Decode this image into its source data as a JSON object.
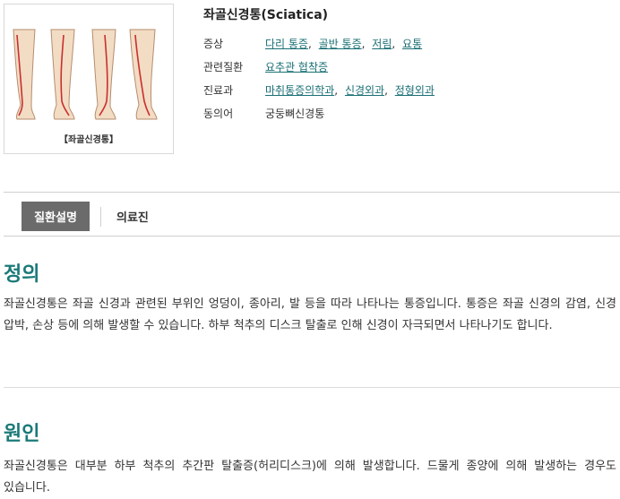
{
  "image": {
    "caption": "【좌골신경통】"
  },
  "disease": {
    "title": "좌골신경통(Sciatica)"
  },
  "info": {
    "symptom_label": "증상",
    "symptoms": [
      "다리 통증",
      "골반 통증",
      "저림",
      "요통"
    ],
    "related_label": "관련질환",
    "related": [
      "요추관 협착증"
    ],
    "dept_label": "진료과",
    "departments": [
      "마취통증의학과",
      "신경외과",
      "정형외과"
    ],
    "synonym_label": "동의어",
    "synonym": "궁둥뼈신경통"
  },
  "tabs": {
    "active": "질환설명",
    "other": "의료진"
  },
  "sections": {
    "definition": {
      "heading": "정의",
      "body": "좌골신경통은 좌골 신경과 관련된 부위인 엉덩이, 종아리, 발 등을 따라 나타나는 통증입니다. 통증은 좌골 신경의 감염, 신경 압박, 손상 등에 의해 발생할 수 있습니다. 하부 척추의 디스크 탈출로 인해 신경이 자극되면서 나타나기도 합니다."
    },
    "cause": {
      "heading": "원인",
      "body": "좌골신경통은 대부분 하부 척추의 추간판 탈출증(허리디스크)에 의해 발생합니다. 드물게 종양에 의해 발생하는 경우도 있습니다."
    }
  },
  "colors": {
    "accent": "#1a7a78",
    "link": "#1a6f74",
    "tab_active_bg": "#6b6b6b"
  }
}
